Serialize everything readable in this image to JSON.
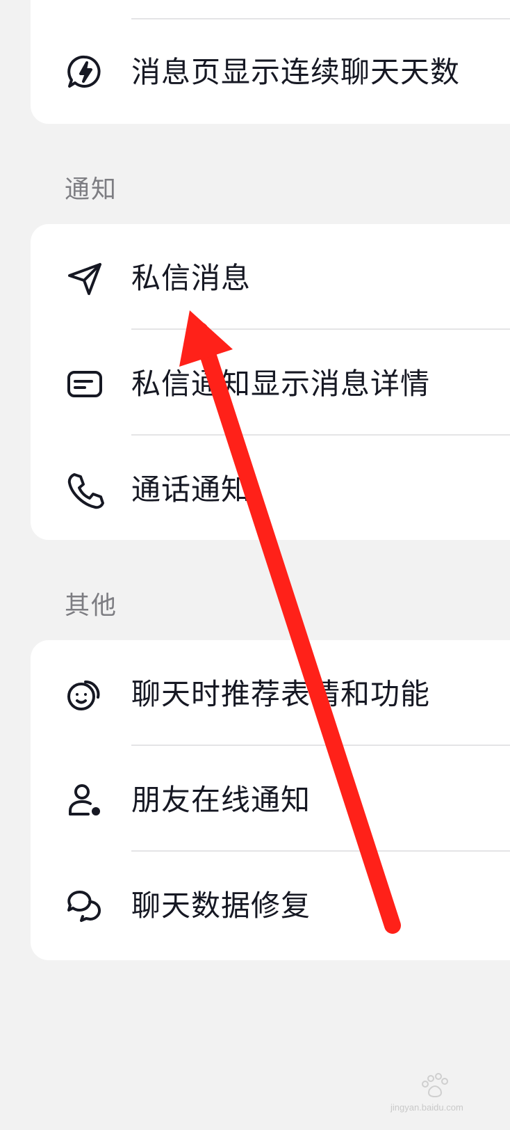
{
  "card_top": {
    "items": [
      {
        "label": "消息页显示连续聊天天数",
        "icon": "lightning-bubble-icon"
      }
    ]
  },
  "sections": {
    "notify": {
      "title": "通知",
      "items": [
        {
          "label": "私信消息",
          "icon": "paper-plane-icon"
        },
        {
          "label": "私信通知显示消息详情",
          "icon": "message-card-icon"
        },
        {
          "label": "通话通知",
          "icon": "phone-icon"
        }
      ]
    },
    "other": {
      "title": "其他",
      "items": [
        {
          "label": "聊天时推荐表情和功能",
          "icon": "smiley-bubble-icon"
        },
        {
          "label": "朋友在线通知",
          "icon": "user-online-icon"
        },
        {
          "label": "聊天数据修复",
          "icon": "chat-bubbles-icon"
        }
      ]
    }
  },
  "annotation": {
    "color": "#ff2119"
  },
  "watermark": {
    "text": "jingyan.baidu.com",
    "icon": "baidu-jingyan-logo"
  }
}
